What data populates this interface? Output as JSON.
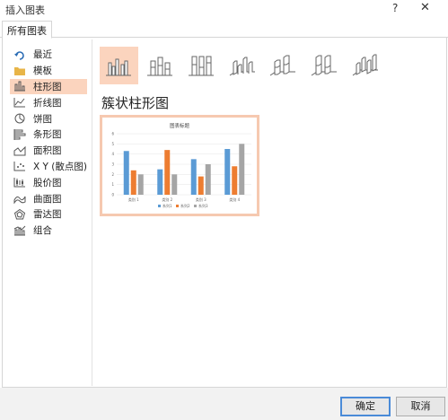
{
  "window": {
    "title": "插入图表",
    "help": "?",
    "close": "✕"
  },
  "tabs": [
    {
      "label": "所有图表"
    }
  ],
  "sidebar": {
    "items": [
      {
        "label": "最近",
        "icon": "undo-arrow-icon"
      },
      {
        "label": "模板",
        "icon": "folder-icon"
      },
      {
        "label": "柱形图",
        "icon": "column-chart-icon"
      },
      {
        "label": "折线图",
        "icon": "line-chart-icon"
      },
      {
        "label": "饼图",
        "icon": "pie-chart-icon"
      },
      {
        "label": "条形图",
        "icon": "bar-chart-icon"
      },
      {
        "label": "面积图",
        "icon": "area-chart-icon"
      },
      {
        "label": "X Y (散点图)",
        "icon": "scatter-chart-icon"
      },
      {
        "label": "股价图",
        "icon": "stock-chart-icon"
      },
      {
        "label": "曲面图",
        "icon": "surface-chart-icon"
      },
      {
        "label": "雷达图",
        "icon": "radar-chart-icon"
      },
      {
        "label": "组合",
        "icon": "combo-chart-icon"
      }
    ],
    "selected": "柱形图"
  },
  "variants": [
    {
      "icon": "clustered-column-icon",
      "selected": true
    },
    {
      "icon": "stacked-column-icon",
      "selected": false
    },
    {
      "icon": "stacked-100-column-icon",
      "selected": false
    },
    {
      "icon": "clustered-3d-column-icon",
      "selected": false
    },
    {
      "icon": "stacked-3d-column-icon",
      "selected": false
    },
    {
      "icon": "stacked-100-3d-column-icon",
      "selected": false
    },
    {
      "icon": "3d-column-icon",
      "selected": false
    }
  ],
  "preview": {
    "heading": "簇状柱形图",
    "chart_title": "图表标题"
  },
  "chart_data": {
    "type": "bar",
    "title": "图表标题",
    "categories": [
      "类别 1",
      "类别 2",
      "类别 3",
      "类别 4"
    ],
    "series": [
      {
        "name": "系列1",
        "values": [
          4.3,
          2.5,
          3.5,
          4.5
        ],
        "color": "#5b9bd5"
      },
      {
        "name": "系列2",
        "values": [
          2.4,
          4.4,
          1.8,
          2.8
        ],
        "color": "#ed7d31"
      },
      {
        "name": "系列3",
        "values": [
          2.0,
          2.0,
          3.0,
          5.0
        ],
        "color": "#a5a5a5"
      }
    ],
    "ylim": [
      0,
      6
    ],
    "yticks": [
      0,
      1,
      2,
      3,
      4,
      5,
      6
    ],
    "grid": true,
    "legend": "bottom"
  },
  "footer": {
    "ok_label": "确定",
    "cancel_label": "取消"
  },
  "colors": {
    "selected_bg": "#fbd4be",
    "accent_blue": "#4a8bd8"
  }
}
